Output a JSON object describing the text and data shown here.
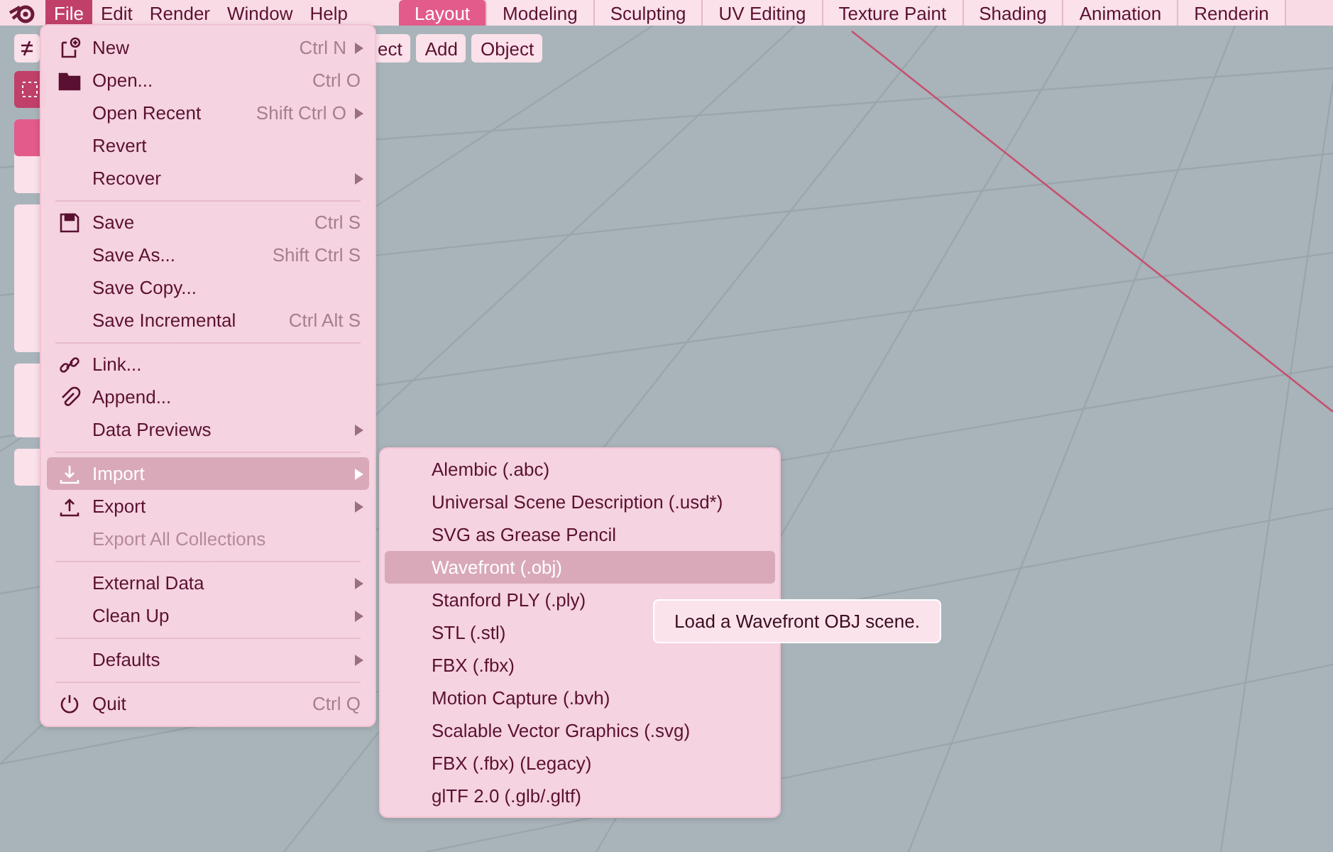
{
  "menubar": {
    "menus": [
      {
        "label": "File",
        "selected": true
      },
      {
        "label": "Edit",
        "selected": false
      },
      {
        "label": "Render",
        "selected": false
      },
      {
        "label": "Window",
        "selected": false
      },
      {
        "label": "Help",
        "selected": false
      }
    ],
    "workspaces": [
      {
        "label": "Layout",
        "selected": true
      },
      {
        "label": "Modeling",
        "selected": false
      },
      {
        "label": "Sculpting",
        "selected": false
      },
      {
        "label": "UV Editing",
        "selected": false
      },
      {
        "label": "Texture Paint",
        "selected": false
      },
      {
        "label": "Shading",
        "selected": false
      },
      {
        "label": "Animation",
        "selected": false
      },
      {
        "label": "Renderin",
        "selected": false
      }
    ]
  },
  "viewport_header": {
    "buttons": [
      "ect",
      "Add",
      "Object"
    ]
  },
  "file_menu": {
    "groups": [
      [
        {
          "label": "New",
          "shortcut": "Ctrl N",
          "kind": "new",
          "has_submenu": true,
          "disabled": false,
          "selected": false
        },
        {
          "label": "Open...",
          "shortcut": "Ctrl O",
          "kind": "open",
          "has_submenu": false,
          "disabled": false,
          "selected": false
        },
        {
          "label": "Open Recent",
          "shortcut": "Shift Ctrl O",
          "has_submenu": true,
          "disabled": false,
          "selected": false
        },
        {
          "label": "Revert",
          "has_submenu": false,
          "disabled": false,
          "selected": false
        },
        {
          "label": "Recover",
          "has_submenu": true,
          "disabled": false,
          "selected": false
        }
      ],
      [
        {
          "label": "Save",
          "shortcut": "Ctrl S",
          "kind": "save",
          "has_submenu": false,
          "disabled": false,
          "selected": false
        },
        {
          "label": "Save As...",
          "shortcut": "Shift Ctrl S",
          "has_submenu": false,
          "disabled": false,
          "selected": false
        },
        {
          "label": "Save Copy...",
          "has_submenu": false,
          "disabled": false,
          "selected": false
        },
        {
          "label": "Save Incremental",
          "shortcut": "Ctrl Alt S",
          "has_submenu": false,
          "disabled": false,
          "selected": false
        }
      ],
      [
        {
          "label": "Link...",
          "kind": "link",
          "has_submenu": false,
          "disabled": false,
          "selected": false
        },
        {
          "label": "Append...",
          "kind": "append",
          "has_submenu": false,
          "disabled": false,
          "selected": false
        },
        {
          "label": "Data Previews",
          "has_submenu": true,
          "disabled": false,
          "selected": false
        }
      ],
      [
        {
          "label": "Import",
          "kind": "import",
          "has_submenu": true,
          "disabled": false,
          "selected": true
        },
        {
          "label": "Export",
          "kind": "export",
          "has_submenu": true,
          "disabled": false,
          "selected": false
        },
        {
          "label": "Export All Collections",
          "has_submenu": false,
          "disabled": true,
          "selected": false
        }
      ],
      [
        {
          "label": "External Data",
          "has_submenu": true,
          "disabled": false,
          "selected": false
        },
        {
          "label": "Clean Up",
          "has_submenu": true,
          "disabled": false,
          "selected": false
        }
      ],
      [
        {
          "label": "Defaults",
          "has_submenu": true,
          "disabled": false,
          "selected": false
        }
      ],
      [
        {
          "label": "Quit",
          "shortcut": "Ctrl Q",
          "kind": "quit",
          "has_submenu": false,
          "disabled": false,
          "selected": false
        }
      ]
    ]
  },
  "import_menu": {
    "items": [
      {
        "label": "Alembic (.abc)",
        "selected": false
      },
      {
        "label": "Universal Scene Description (.usd*)",
        "selected": false
      },
      {
        "label": "SVG as Grease Pencil",
        "selected": false
      },
      {
        "label": "Wavefront (.obj)",
        "selected": true
      },
      {
        "label": "Stanford PLY (.ply)",
        "selected": false
      },
      {
        "label": "STL (.stl)",
        "selected": false
      },
      {
        "label": "FBX (.fbx)",
        "selected": false
      },
      {
        "label": "Motion Capture (.bvh)",
        "selected": false
      },
      {
        "label": "Scalable Vector Graphics (.svg)",
        "selected": false
      },
      {
        "label": "FBX (.fbx) (Legacy)",
        "selected": false
      },
      {
        "label": "glTF 2.0 (.glb/.gltf)",
        "selected": false
      }
    ]
  },
  "tooltip": {
    "text": "Load a Wavefront OBJ scene."
  }
}
